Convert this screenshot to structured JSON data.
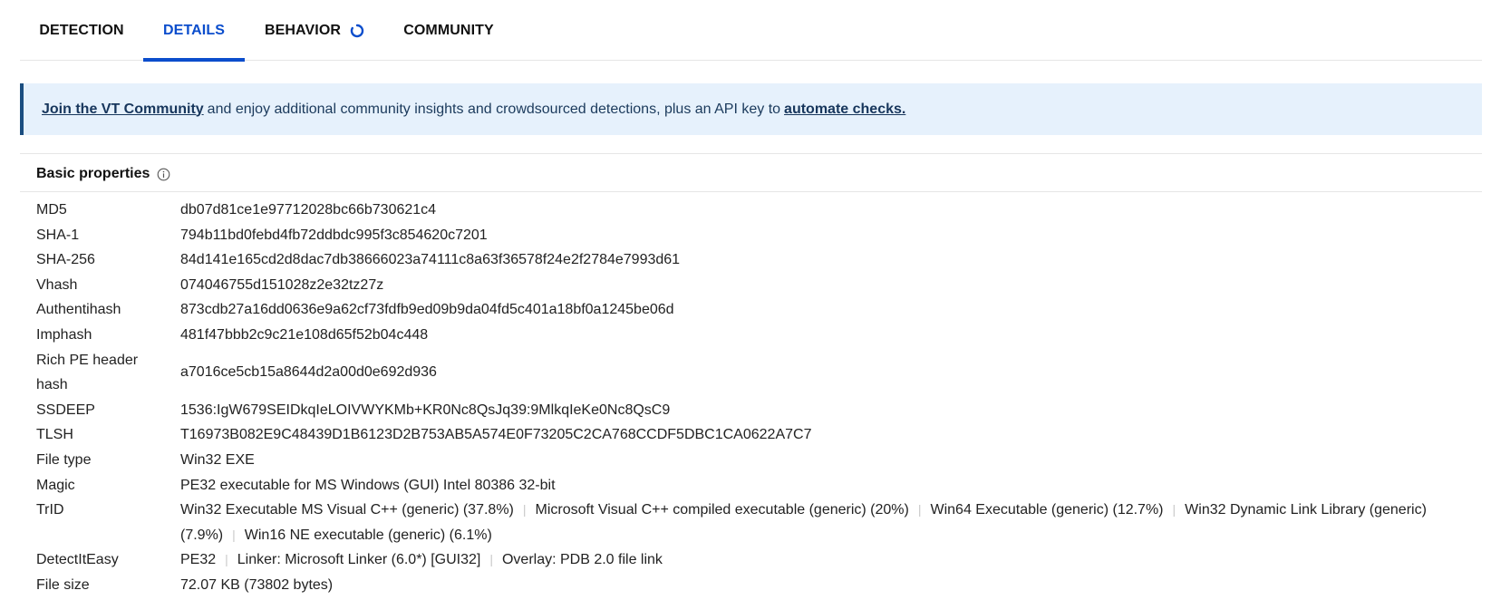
{
  "tabs": [
    {
      "label": "DETECTION",
      "active": false
    },
    {
      "label": "DETAILS",
      "active": true
    },
    {
      "label": "BEHAVIOR",
      "active": false,
      "loading": true
    },
    {
      "label": "COMMUNITY",
      "active": false
    }
  ],
  "banner": {
    "link1": "Join the VT Community",
    "middle": "and enjoy additional community insights and crowdsourced detections, plus an API key to",
    "link2": "automate checks."
  },
  "section": {
    "title": "Basic properties",
    "icon": "info-icon"
  },
  "properties": {
    "md5": {
      "label": "MD5",
      "value": "db07d81ce1e97712028bc66b730621c4"
    },
    "sha1": {
      "label": "SHA-1",
      "value": "794b11bd0febd4fb72ddbdc995f3c854620c7201"
    },
    "sha256": {
      "label": "SHA-256",
      "value": "84d141e165cd2d8dac7db38666023a74111c8a63f36578f24e2f2784e7993d61"
    },
    "vhash": {
      "label": "Vhash",
      "value": "074046755d151028z2e32tz27z"
    },
    "authentihash": {
      "label": "Authentihash",
      "value": "873cdb27a16dd0636e9a62cf73fdfb9ed09b9da04fd5c401a18bf0a1245be06d"
    },
    "imphash": {
      "label": "Imphash",
      "value": "481f47bbb2c9c21e108d65f52b04c448"
    },
    "rich_pe": {
      "label_line1": "Rich PE header",
      "label_line2": "hash",
      "value": "a7016ce5cb15a8644d2a00d0e692d936"
    },
    "ssdeep": {
      "label": "SSDEEP",
      "value": "1536:IgW679SEIDkqIeLOIVWYKMb+KR0Nc8QsJq39:9MlkqIeKe0Nc8QsC9"
    },
    "tlsh": {
      "label": "TLSH",
      "value": "T16973B082E9C48439D1B6123D2B753AB5A574E0F73205C2CA768CCDF5DBC1CA0622A7C7"
    },
    "file_type": {
      "label": "File type",
      "value": "Win32 EXE"
    },
    "magic": {
      "label": "Magic",
      "value": "PE32 executable for MS Windows (GUI) Intel 80386 32-bit"
    },
    "trid": {
      "label": "TrID",
      "items": [
        "Win32 Executable MS Visual C++ (generic) (37.8%)",
        "Microsoft Visual C++ compiled executable (generic) (20%)",
        "Win64 Executable (generic) (12.7%)",
        "Win32 Dynamic Link Library (generic)",
        "(7.9%)",
        "Win16 NE executable (generic) (6.1%)"
      ]
    },
    "detectiteasy": {
      "label": "DetectItEasy",
      "items": [
        "PE32",
        "Linker: Microsoft Linker (6.0*) [GUI32]",
        "Overlay: PDB 2.0 file link"
      ]
    },
    "file_size": {
      "label": "File size",
      "value": "72.07 KB (73802 bytes)"
    }
  },
  "colors": {
    "accent": "#0b4dcc",
    "banner_bg": "#e6f1fc",
    "banner_border": "#1b4e80"
  }
}
